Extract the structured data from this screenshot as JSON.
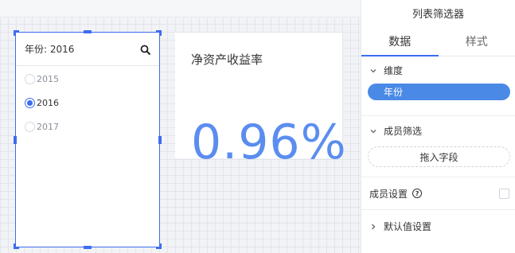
{
  "filter_widget": {
    "title": "年份: 2016",
    "options": [
      {
        "label": "2015",
        "selected": false
      },
      {
        "label": "2016",
        "selected": true
      },
      {
        "label": "2017",
        "selected": false
      }
    ]
  },
  "kpi": {
    "title": "净资产收益率",
    "value": "0.96%"
  },
  "panel": {
    "title": "列表筛选器",
    "tabs": [
      {
        "label": "数据",
        "active": true
      },
      {
        "label": "样式",
        "active": false
      }
    ],
    "dimension": {
      "label": "维度",
      "field": "年份"
    },
    "member_filter": {
      "label": "成员筛选",
      "drop_label": "拖入字段"
    },
    "member_settings": {
      "label": "成员设置",
      "help": "?"
    },
    "default_settings": {
      "label": "默认值设置"
    }
  },
  "colors": {
    "accent": "#3d6cf0",
    "kpi_value": "#5b8def",
    "pill": "#4a8ae6"
  }
}
